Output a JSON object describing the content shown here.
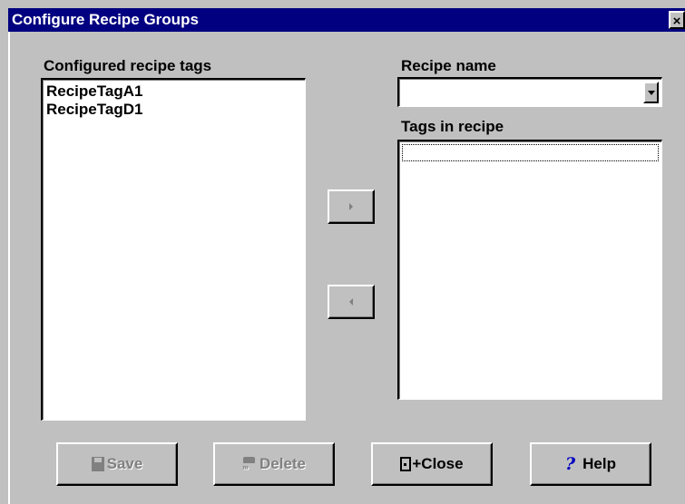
{
  "window": {
    "title": "Configure Recipe Groups",
    "close_glyph": "×"
  },
  "configured_tags": {
    "label": "Configured recipe tags",
    "items": [
      "RecipeTagA1",
      "RecipeTagD1"
    ]
  },
  "recipe_name": {
    "label": "Recipe name",
    "value": ""
  },
  "tags_in_recipe": {
    "label": "Tags in recipe",
    "items": []
  },
  "buttons": {
    "save": "Save",
    "delete": "Delete",
    "close": "+Close",
    "help": "Help",
    "help_glyph": "?"
  },
  "icons": {
    "save": "floppy-disk-icon",
    "delete": "trash-icon",
    "close": "exit-door-icon",
    "help": "question-mark-icon",
    "add": "arrow-right-icon",
    "remove": "arrow-left-icon"
  }
}
